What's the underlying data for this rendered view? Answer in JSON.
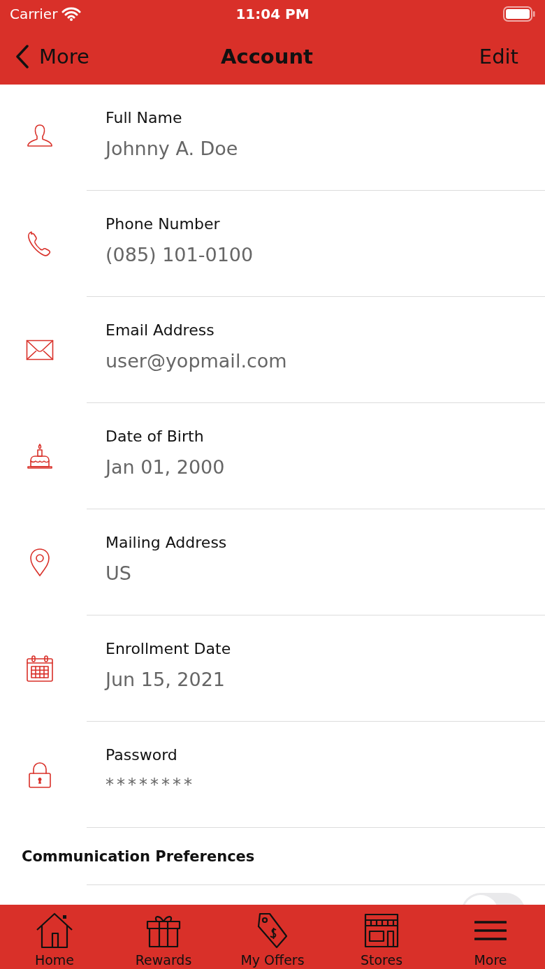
{
  "status_bar": {
    "carrier": "Carrier",
    "time": "11:04 PM"
  },
  "nav_bar": {
    "back": "More",
    "title": "Account",
    "action": "Edit"
  },
  "fields": [
    {
      "kind": "person",
      "label": "Full Name",
      "value": "Johnny A. Doe"
    },
    {
      "kind": "phone",
      "label": "Phone Number",
      "value": "(085) 101-0100"
    },
    {
      "kind": "mail",
      "label": "Email Address",
      "value": "user@yopmail.com"
    },
    {
      "kind": "cake",
      "label": "Date of Birth",
      "value": "Jan 01, 2000"
    },
    {
      "kind": "pin",
      "label": "Mailing Address",
      "value": "US"
    },
    {
      "kind": "calendar",
      "label": "Enrollment Date",
      "value": "Jun 15, 2021"
    },
    {
      "kind": "lock",
      "label": "Password",
      "value": "********"
    }
  ],
  "section_header": "Communication Preferences",
  "partial_toggle": {
    "on": false
  },
  "tab_bar": [
    {
      "kind": "home",
      "label": "Home"
    },
    {
      "kind": "gift",
      "label": "Rewards"
    },
    {
      "kind": "tag",
      "label": "My Offers"
    },
    {
      "kind": "store",
      "label": "Stores"
    },
    {
      "kind": "menu",
      "label": "More"
    }
  ]
}
